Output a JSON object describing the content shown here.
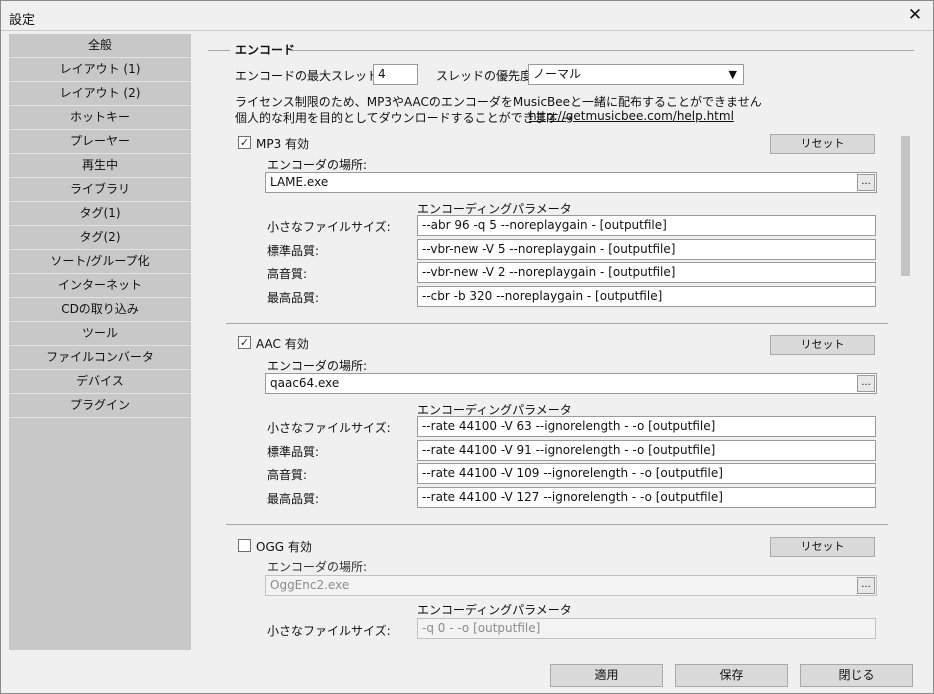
{
  "window": {
    "title": "設定",
    "close_label": "✕"
  },
  "sidebar": {
    "items": [
      "全般",
      "レイアウト (1)",
      "レイアウト (2)",
      "ホットキー",
      "プレーヤー",
      "再生中",
      "ライブラリ",
      "タグ(1)",
      "タグ(2)",
      "ソート/グループ化",
      "インターネット",
      "CDの取り込み",
      "ツール",
      "ファイルコンバータ",
      "デバイス",
      "プラグイン"
    ]
  },
  "encode": {
    "section_title": "エンコード",
    "max_threads_label": "エンコードの最大スレッド数:",
    "max_threads_value": "4",
    "thread_priority_label": "スレッドの優先度:",
    "thread_priority_value": "ノーマル",
    "license_note_1": "ライセンス制限のため、MP3やAACのエンコーダをMusicBeeと一緒に配布することができません",
    "license_note_2": "個人的な利用を目的としてダウンロードすることができます →",
    "help_link": "http://getmusicbee.com/help.html"
  },
  "encoders": [
    {
      "enabled_label": "MP3 有効",
      "checked": true,
      "reset_label": "リセット",
      "location_label": "エンコーダの場所:",
      "location_value": "LAME.exe",
      "params_label": "エンコーディングパラメータ",
      "rows": [
        {
          "label": "小さなファイルサイズ:",
          "value": "--abr 96 -q 5 --noreplaygain - [outputfile]"
        },
        {
          "label": "標準品質:",
          "value": "--vbr-new -V 5 --noreplaygain - [outputfile]"
        },
        {
          "label": "高音質:",
          "value": "--vbr-new -V 2 --noreplaygain - [outputfile]"
        },
        {
          "label": "最高品質:",
          "value": "--cbr -b 320 --noreplaygain - [outputfile]"
        }
      ]
    },
    {
      "enabled_label": "AAC 有効",
      "checked": true,
      "reset_label": "リセット",
      "location_label": "エンコーダの場所:",
      "location_value": "qaac64.exe",
      "params_label": "エンコーディングパラメータ",
      "rows": [
        {
          "label": "小さなファイルサイズ:",
          "value": "--rate 44100 -V 63 --ignorelength - -o [outputfile]"
        },
        {
          "label": "標準品質:",
          "value": "--rate 44100 -V 91 --ignorelength - -o [outputfile]"
        },
        {
          "label": "高音質:",
          "value": "--rate 44100 -V 109 --ignorelength - -o [outputfile]"
        },
        {
          "label": "最高品質:",
          "value": "--rate 44100 -V 127 --ignorelength - -o [outputfile]"
        }
      ]
    },
    {
      "enabled_label": "OGG 有効",
      "checked": false,
      "reset_label": "リセット",
      "location_label": "エンコーダの場所:",
      "location_value": "OggEnc2.exe",
      "params_label": "エンコーディングパラメータ",
      "rows": [
        {
          "label": "小さなファイルサイズ:",
          "value": "-q 0 - -o [outputfile]"
        }
      ]
    }
  ],
  "icons": {
    "browse": "...",
    "dropdown": "▼",
    "check": "✓"
  },
  "footer": {
    "apply_label": "適用",
    "save_label": "保存",
    "close_label": "閉じる"
  }
}
